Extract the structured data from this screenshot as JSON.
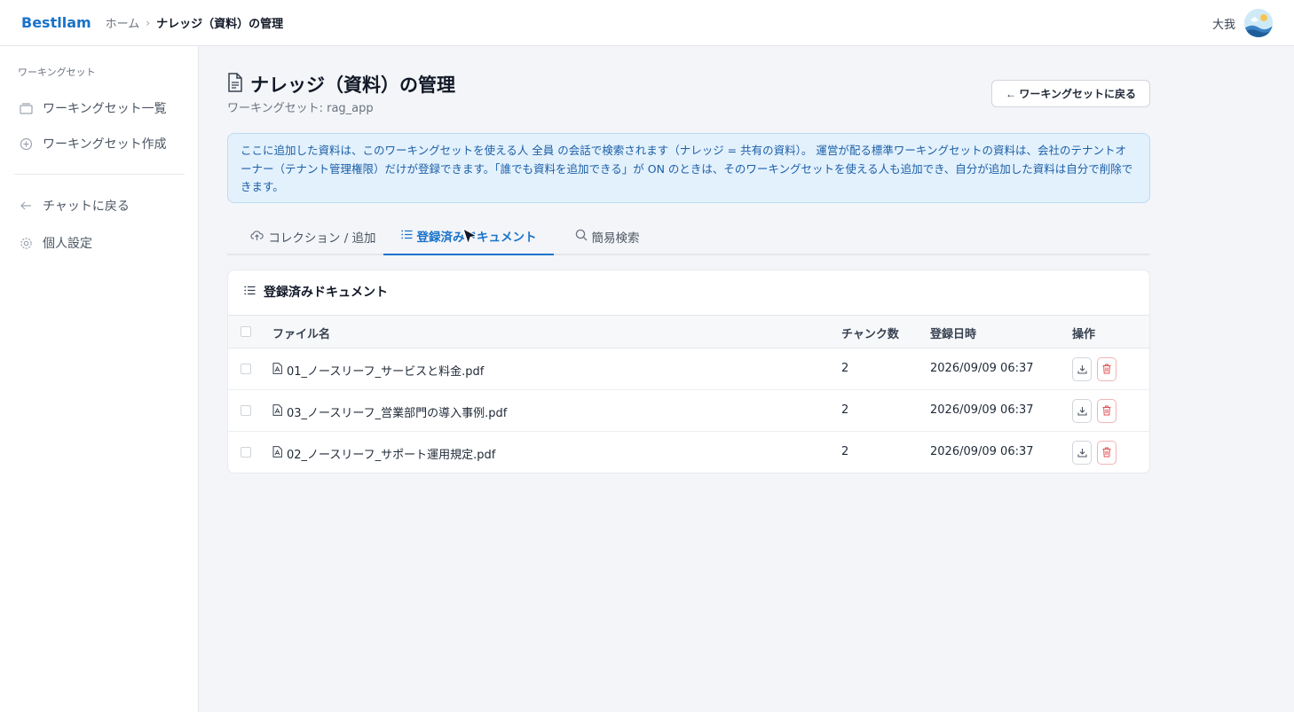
{
  "header": {
    "brand": "Bestllam",
    "breadcrumb_home": "ホーム",
    "breadcrumb_separator": "›",
    "breadcrumb_current": "ナレッジ（資料）の管理",
    "user_name": "大我"
  },
  "sidebar": {
    "section_label": "ワーキングセット",
    "items": [
      {
        "label": "ワーキングセット一覧",
        "icon": "folder-icon"
      },
      {
        "label": "ワーキングセット作成",
        "icon": "plus-circle-icon"
      },
      {
        "label": "チャットに戻る",
        "icon": "arrow-left-icon"
      },
      {
        "label": "個人設定",
        "icon": "gear-icon"
      }
    ]
  },
  "page": {
    "title": "ナレッジ（資料）の管理",
    "subtitle": "ワーキングセット: rag_app",
    "back_button": "← ワーキングセットに戻る",
    "info_text": "ここに追加した資料は、このワーキングセットを使える人 全員 の会話で検索されます（ナレッジ = 共有の資料）。 運営が配る標準ワーキングセットの資料は、会社のテナントオーナー（テナント管理権限）だけが登録できます。「誰でも資料を追加できる」が ON のときは、そのワーキングセットを使える人も追加でき、自分が追加した資料は自分で削除できます。"
  },
  "tabs": [
    {
      "label": "コレクション / 追加",
      "icon": "cloud-upload-icon",
      "active": false
    },
    {
      "label": "登録済みドキュメント",
      "icon": "list-icon",
      "active": true
    },
    {
      "label": "簡易検索",
      "icon": "search-icon",
      "active": false
    }
  ],
  "documents": {
    "heading": "登録済みドキュメント",
    "columns": {
      "filename": "ファイル名",
      "chunks": "チャンク数",
      "registered_at": "登録日時",
      "actions": "操作"
    },
    "rows": [
      {
        "filename": "01_ノースリーフ_サービスと料金.pdf",
        "chunks": "2",
        "registered_at": "2026/09/09 06:37"
      },
      {
        "filename": "03_ノースリーフ_営業部門の導入事例.pdf",
        "chunks": "2",
        "registered_at": "2026/09/09 06:37"
      },
      {
        "filename": "02_ノースリーフ_サポート運用規定.pdf",
        "chunks": "2",
        "registered_at": "2026/09/09 06:37"
      }
    ]
  },
  "colors": {
    "accent": "#1a73c9",
    "info_bg": "#e3f1fd",
    "danger": "#e05252"
  }
}
